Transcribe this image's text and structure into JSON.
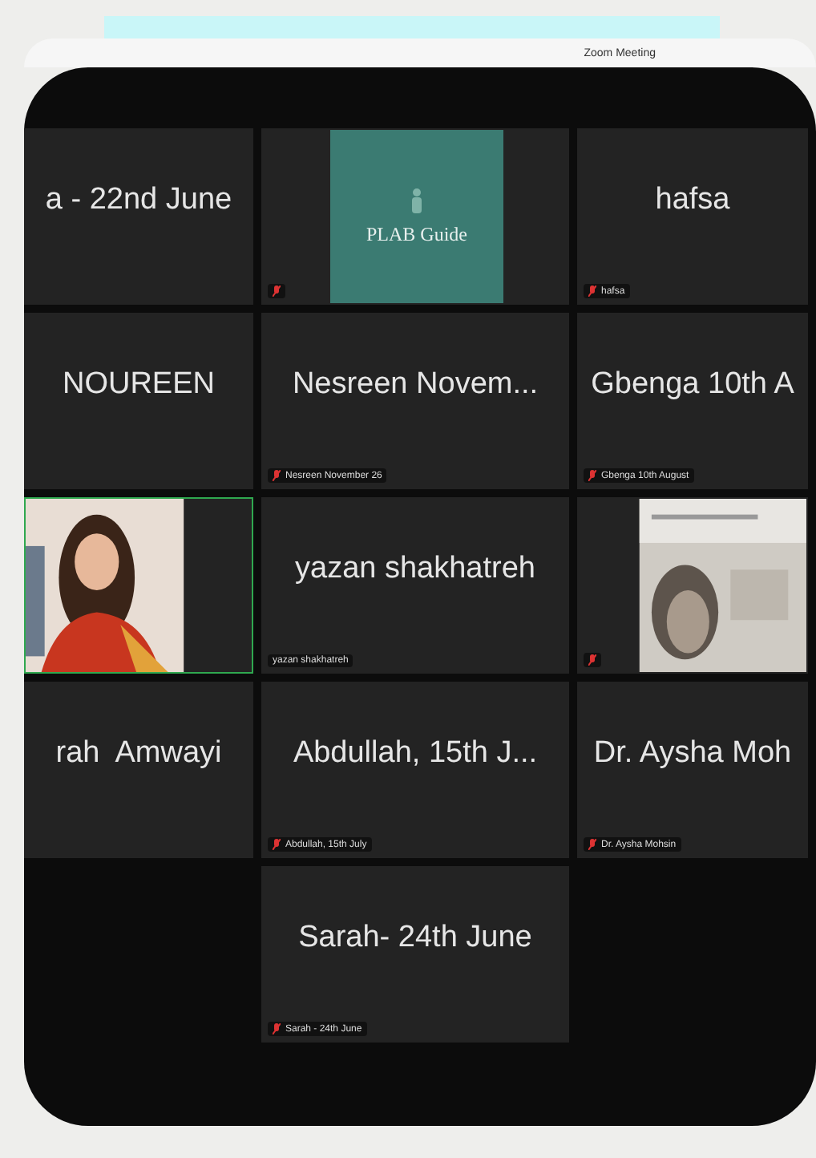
{
  "window": {
    "title": "Zoom Meeting"
  },
  "rows": [
    {
      "tiles": [
        {
          "kind": "name",
          "display": "a - 22nd June",
          "muted": false,
          "speaking": false
        },
        {
          "kind": "avatar",
          "display": "PLAB Guide",
          "muted": true,
          "speaking": false
        },
        {
          "kind": "name",
          "display": "hafsa",
          "label": "hafsa",
          "muted": true,
          "speaking": false
        }
      ]
    },
    {
      "tiles": [
        {
          "kind": "name",
          "display": "NOUREEN",
          "muted": false,
          "speaking": false
        },
        {
          "kind": "name",
          "display": "Nesreen Novem...",
          "label": "Nesreen November 26",
          "muted": true,
          "speaking": false
        },
        {
          "kind": "name",
          "display": "Gbenga 10th A",
          "label": "Gbenga 10th August",
          "muted": true,
          "speaking": false
        }
      ]
    },
    {
      "tiles": [
        {
          "kind": "video",
          "muted": false,
          "speaking": true
        },
        {
          "kind": "name",
          "display": "yazan shakhatreh",
          "label": "yazan shakhatreh",
          "muted": false,
          "speaking": false
        },
        {
          "kind": "video",
          "muted": true,
          "speaking": false
        }
      ]
    },
    {
      "tiles": [
        {
          "kind": "name",
          "display": "rah  Amwayi",
          "muted": false,
          "speaking": false
        },
        {
          "kind": "name",
          "display": "Abdullah, 15th J...",
          "label": "Abdullah, 15th July",
          "muted": true,
          "speaking": false
        },
        {
          "kind": "name",
          "display": "Dr. Aysha Moh",
          "label": "Dr. Aysha Mohsin",
          "muted": true,
          "speaking": false
        }
      ]
    },
    {
      "tiles": [
        {
          "kind": "name",
          "display": "Sarah- 24th June",
          "label": "Sarah - 24th June",
          "muted": true,
          "speaking": false
        }
      ]
    }
  ]
}
